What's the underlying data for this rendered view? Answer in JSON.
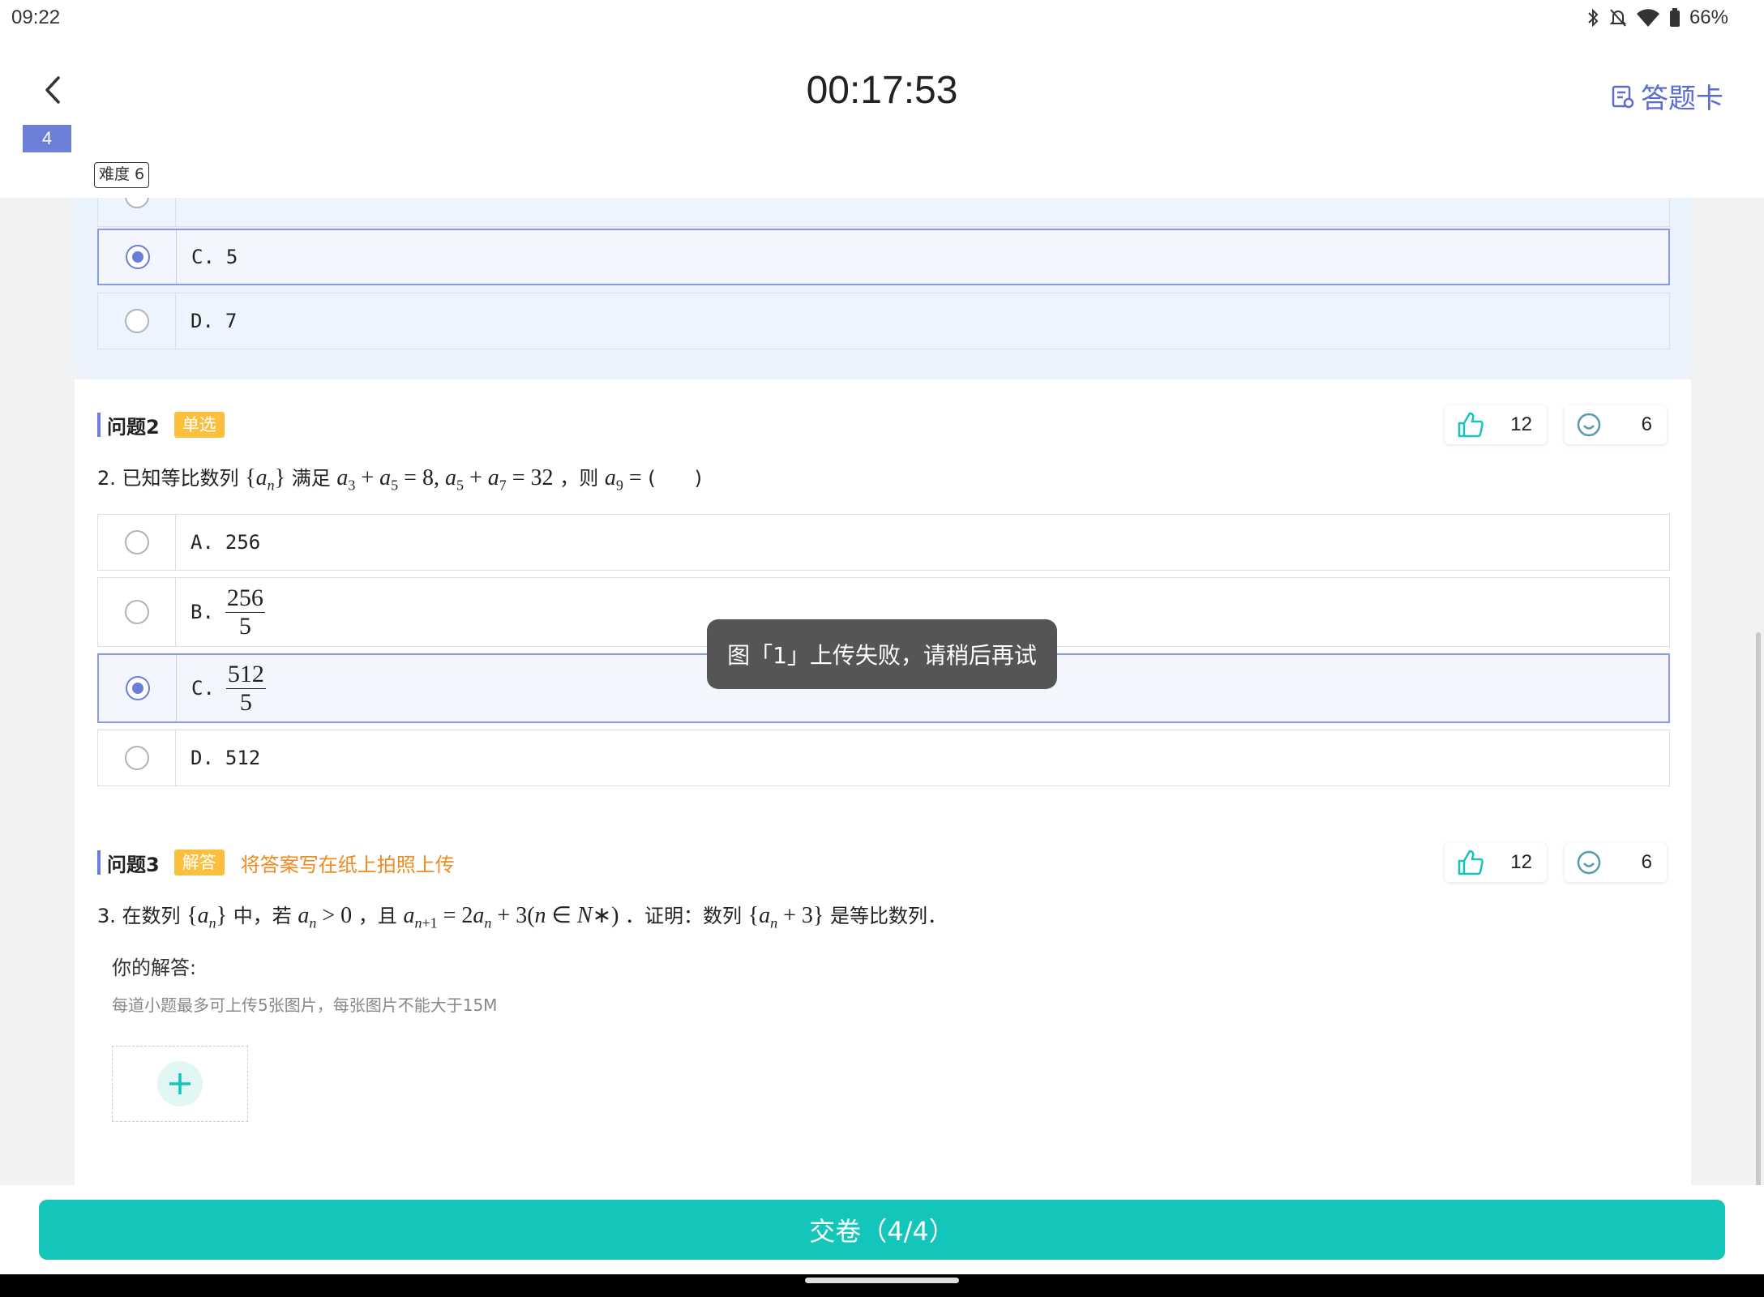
{
  "status_bar": {
    "time": "09:22",
    "battery": "66%",
    "icons": [
      "bluetooth-icon",
      "mute-icon",
      "wifi-icon",
      "battery-icon"
    ]
  },
  "header": {
    "timer": "00:17:53",
    "answer_card_label": "答题卡",
    "question_index": "4",
    "difficulty": "难度 6"
  },
  "question1_options": [
    {
      "letter": "C.",
      "value": "5",
      "selected": true
    },
    {
      "letter": "D.",
      "value": "7",
      "selected": false
    }
  ],
  "question2": {
    "title": "问题2",
    "tag": "单选",
    "likes": "12",
    "smiles": "6",
    "number": "2.",
    "text_prefix": "已知等比数列",
    "text_satisfies": "满足",
    "text_then": "，则",
    "text_paren": "(　　)",
    "math": {
      "seq": "{a",
      "cond": "a",
      "target": "a"
    },
    "options": [
      {
        "letter": "A.",
        "value": "256",
        "selected": false
      },
      {
        "letter": "B.",
        "num": "256",
        "den": "5",
        "selected": false
      },
      {
        "letter": "C.",
        "num": "512",
        "den": "5",
        "selected": true
      },
      {
        "letter": "D.",
        "value": "512",
        "selected": false
      }
    ]
  },
  "question3": {
    "title": "问题3",
    "tag": "解答",
    "hint": "将答案写在纸上拍照上传",
    "likes": "12",
    "smiles": "6",
    "number": "3.",
    "text_a": "在数列",
    "text_b": "中，若",
    "text_c": "，且",
    "text_d": "．证明：数列",
    "text_e": "是等比数列．",
    "your_answer_label": "你的解答:",
    "upload_hint": "每道小题最多可上传5张图片，每张图片不能大于15M"
  },
  "toast": "图「1」上传失败，请稍后再试",
  "submit_label": "交卷（4/4）",
  "colors": {
    "accent": "#6b7fd7",
    "submit": "#13c6b9",
    "tag_orange": "#fbbf3e",
    "hint_orange": "#f08a1e"
  }
}
